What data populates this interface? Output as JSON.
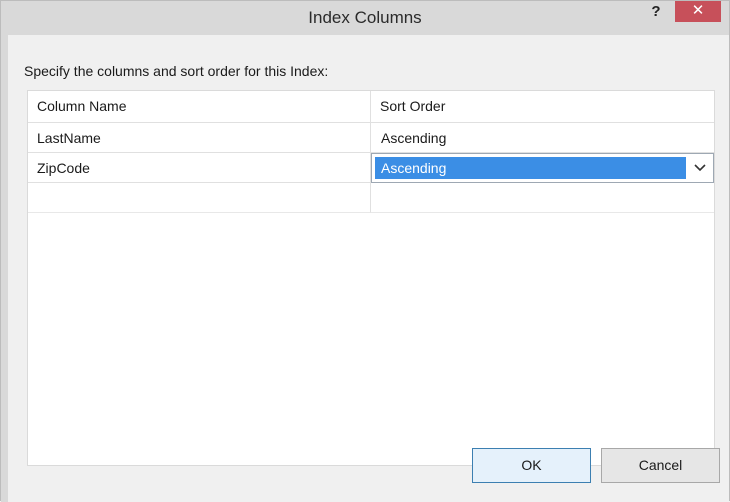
{
  "window": {
    "title": "Index Columns",
    "help_label": "?",
    "close_label": "✕"
  },
  "instructions": "Specify the columns and sort order for this Index:",
  "grid": {
    "columns": [
      "Column Name",
      "Sort Order"
    ],
    "rows": [
      {
        "column_name": "LastName",
        "sort_order": "Ascending"
      },
      {
        "column_name": "ZipCode",
        "sort_order": "Ascending"
      },
      {
        "column_name": "",
        "sort_order": ""
      }
    ],
    "selected_row_index": 1
  },
  "dropdown_icon": "chevron-down-icon",
  "buttons": {
    "ok": "OK",
    "cancel": "Cancel"
  },
  "colors": {
    "selection": "#3b8ee5",
    "close_button": "#c7505a"
  }
}
